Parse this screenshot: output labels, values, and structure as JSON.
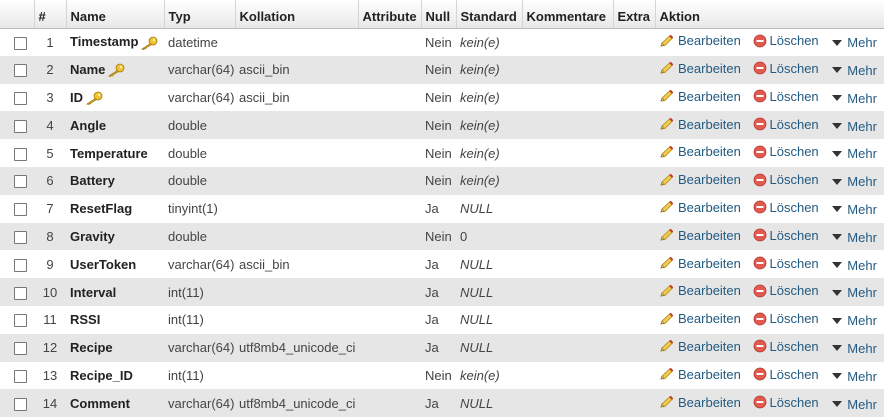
{
  "columns": {
    "number": "#",
    "name": "Name",
    "type": "Typ",
    "collation": "Kollation",
    "attributes": "Attribute",
    "null": "Null",
    "default": "Standard",
    "comments": "Kommentare",
    "extra": "Extra",
    "action": "Aktion"
  },
  "actions": {
    "edit": "Bearbeiten",
    "delete": "Löschen",
    "more": "Mehr"
  },
  "icons": {
    "key": "key-icon",
    "edit": "pencil-icon",
    "delete": "delete-icon",
    "more": "caret-down-icon"
  },
  "rows": [
    {
      "num": "1",
      "name": "Timestamp",
      "key": true,
      "type": "datetime",
      "collation": "",
      "null": "Nein",
      "default": "kein(e)",
      "default_italic": true
    },
    {
      "num": "2",
      "name": "Name",
      "key": true,
      "type": "varchar(64)",
      "collation": "ascii_bin",
      "null": "Nein",
      "default": "kein(e)",
      "default_italic": true
    },
    {
      "num": "3",
      "name": "ID",
      "key": true,
      "type": "varchar(64)",
      "collation": "ascii_bin",
      "null": "Nein",
      "default": "kein(e)",
      "default_italic": true
    },
    {
      "num": "4",
      "name": "Angle",
      "key": false,
      "type": "double",
      "collation": "",
      "null": "Nein",
      "default": "kein(e)",
      "default_italic": true
    },
    {
      "num": "5",
      "name": "Temperature",
      "key": false,
      "type": "double",
      "collation": "",
      "null": "Nein",
      "default": "kein(e)",
      "default_italic": true
    },
    {
      "num": "6",
      "name": "Battery",
      "key": false,
      "type": "double",
      "collation": "",
      "null": "Nein",
      "default": "kein(e)",
      "default_italic": true
    },
    {
      "num": "7",
      "name": "ResetFlag",
      "key": false,
      "type": "tinyint(1)",
      "collation": "",
      "null": "Ja",
      "default": "NULL",
      "default_italic": true
    },
    {
      "num": "8",
      "name": "Gravity",
      "key": false,
      "type": "double",
      "collation": "",
      "null": "Nein",
      "default": "0",
      "default_italic": false
    },
    {
      "num": "9",
      "name": "UserToken",
      "key": false,
      "type": "varchar(64)",
      "collation": "ascii_bin",
      "null": "Ja",
      "default": "NULL",
      "default_italic": true
    },
    {
      "num": "10",
      "name": "Interval",
      "key": false,
      "type": "int(11)",
      "collation": "",
      "null": "Ja",
      "default": "NULL",
      "default_italic": true
    },
    {
      "num": "11",
      "name": "RSSI",
      "key": false,
      "type": "int(11)",
      "collation": "",
      "null": "Ja",
      "default": "NULL",
      "default_italic": true
    },
    {
      "num": "12",
      "name": "Recipe",
      "key": false,
      "type": "varchar(64)",
      "collation": "utf8mb4_unicode_ci",
      "null": "Ja",
      "default": "NULL",
      "default_italic": true
    },
    {
      "num": "13",
      "name": "Recipe_ID",
      "key": false,
      "type": "int(11)",
      "collation": "",
      "null": "Nein",
      "default": "kein(e)",
      "default_italic": true
    },
    {
      "num": "14",
      "name": "Comment",
      "key": false,
      "type": "varchar(64)",
      "collation": "utf8mb4_unicode_ci",
      "null": "Ja",
      "default": "NULL",
      "default_italic": true
    }
  ]
}
